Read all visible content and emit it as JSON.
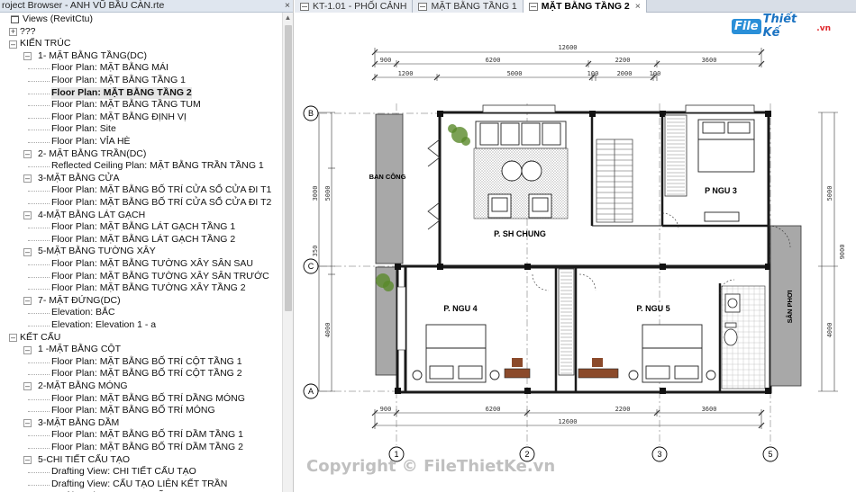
{
  "browser": {
    "title": "roject Browser - ANH VŨ BẦU CÀN.rte",
    "close": "×"
  },
  "tree": [
    {
      "label": "Views (RevitCtu)",
      "level": 0,
      "exp": "-",
      "icon": true
    },
    {
      "label": "???",
      "level": 1,
      "exp": "+"
    },
    {
      "label": "KIẾN TRÚC",
      "level": 1,
      "exp": "-"
    },
    {
      "label": "1- MẶT BẰNG TẦNG(DC)",
      "level": 2,
      "exp": "-"
    },
    {
      "label": "Floor Plan: MẶT BẰNG MÁI",
      "level": 3
    },
    {
      "label": "Floor Plan: MẶT BẰNG TẦNG 1",
      "level": 3
    },
    {
      "label": "Floor Plan: MẶT BẰNG TẦNG 2",
      "level": 3,
      "selected": true
    },
    {
      "label": "Floor Plan: MẶT BẰNG TẦNG TUM",
      "level": 3
    },
    {
      "label": "Floor Plan: MẶT BẰNG ĐỊNH VỊ",
      "level": 3
    },
    {
      "label": "Floor Plan: Site",
      "level": 3
    },
    {
      "label": "Floor Plan: VỈA HÈ",
      "level": 3
    },
    {
      "label": "2- MẶT BẰNG TRẦN(DC)",
      "level": 2,
      "exp": "-"
    },
    {
      "label": "Reflected Ceiling Plan: MẶT BẰNG TRẦN TẦNG 1",
      "level": 3
    },
    {
      "label": "3-MẶT BẰNG CỬA",
      "level": 2,
      "exp": "-"
    },
    {
      "label": "Floor Plan: MẶT BẰNG BỐ TRÍ CỬA SỔ CỬA ĐI T1",
      "level": 3
    },
    {
      "label": "Floor Plan: MẶT BẰNG BỐ TRÍ CỬA SỔ CỬA ĐI T2",
      "level": 3
    },
    {
      "label": "4-MẶT BẰNG LÁT GẠCH",
      "level": 2,
      "exp": "-"
    },
    {
      "label": "Floor Plan: MẶT BẰNG LÁT GẠCH TẦNG 1",
      "level": 3
    },
    {
      "label": "Floor Plan: MẶT BẰNG LÁT GẠCH TẦNG 2",
      "level": 3
    },
    {
      "label": "5-MẶT BẰNG TƯỜNG XÂY",
      "level": 2,
      "exp": "-"
    },
    {
      "label": "Floor Plan: MẶT BẰNG TƯỜNG XÂY SÂN SAU",
      "level": 3
    },
    {
      "label": "Floor Plan: MẶT BẰNG TƯỜNG XÂY SÂN TRƯỚC",
      "level": 3
    },
    {
      "label": "Floor Plan: MẶT BẰNG TƯỜNG XÂY TẦNG 2",
      "level": 3
    },
    {
      "label": "7- MẶT ĐỨNG(DC)",
      "level": 2,
      "exp": "-"
    },
    {
      "label": "Elevation: BẮC",
      "level": 3
    },
    {
      "label": "Elevation: Elevation 1 - a",
      "level": 3
    },
    {
      "label": "KẾT CẤU",
      "level": 1,
      "exp": "-"
    },
    {
      "label": "1 -MẶT BẰNG CỘT",
      "level": 2,
      "exp": "-"
    },
    {
      "label": "Floor Plan: MẶT BẰNG BỐ TRÍ CỘT TẦNG 1",
      "level": 3
    },
    {
      "label": "Floor Plan: MẶT BẰNG BỐ TRÍ CỘT TẦNG 2",
      "level": 3
    },
    {
      "label": "2-MẶT BẰNG MÓNG",
      "level": 2,
      "exp": "-"
    },
    {
      "label": "Floor Plan: MẶT BẰNG BỐ TRÍ DẦNG MÓNG",
      "level": 3
    },
    {
      "label": "Floor Plan: MẶT BẰNG BỐ TRÍ MÓNG",
      "level": 3
    },
    {
      "label": "3-MẶT BẰNG DẦM",
      "level": 2,
      "exp": "-"
    },
    {
      "label": "Floor Plan: MẶT BẰNG BỐ TRÍ DẦM TẦNG 1",
      "level": 3
    },
    {
      "label": "Floor Plan: MẶT BẰNG BỐ TRÍ DẦM TẦNG 2",
      "level": 3
    },
    {
      "label": "5-CHI TIẾT CẤU TẠO",
      "level": 2,
      "exp": "-"
    },
    {
      "label": "Drafting View: CHI TIẾT CẤU TẠO",
      "level": 3
    },
    {
      "label": "Drafting View: CẤU TẠO LIÊN KẾT TRẦN",
      "level": 3
    },
    {
      "label": "Drafting View: CHUNG MỸ",
      "level": 3
    }
  ],
  "tabs": [
    {
      "label": "KT-1.01 - PHỐI CẢNH",
      "active": false,
      "closable": false
    },
    {
      "label": "MẶT BẰNG TẦNG 1",
      "active": false,
      "closable": false
    },
    {
      "label": "MẶT BẰNG TẦNG 2",
      "active": true,
      "closable": true
    }
  ],
  "tab_close": "×",
  "drawing": {
    "rooms": {
      "ban_cong": "BAN CÔNG",
      "sh_chung": "P. SH CHUNG",
      "ngu3": "P NGU 3",
      "ngu4": "P. NGU 4",
      "ngu5": "P. NGU 5",
      "san_phoi": "SÂN PHƠI"
    },
    "dims_top": {
      "total": "12600",
      "a": "900",
      "b": "6200",
      "c": "2200",
      "d": "3600",
      "e": "1200",
      "f": "5000",
      "g": "100",
      "h": "2000",
      "i": "100"
    },
    "dims_bottom": {
      "total": "12600",
      "a": "900",
      "b": "6200",
      "c": "2200",
      "d": "3600"
    },
    "dims_left": {
      "a": "3000",
      "b": "5000",
      "c": "350",
      "d": "4000"
    },
    "dims_right": {
      "a": "5000",
      "b": "9000",
      "c": "4000"
    },
    "grid_rows": [
      "B",
      "C",
      "A"
    ],
    "grid_cols": [
      "1",
      "2",
      "3",
      "5"
    ]
  },
  "logo": {
    "badge": "File",
    "text": "Thiết Kế",
    "tld": ".vn"
  },
  "watermark": "Copyright © FileThietKe.vn",
  "colors": {
    "wall": "#1a1a1a",
    "hatch": "#9a9a9a",
    "balcony_fill": "#a8a8a8",
    "wood": "#8b4a2b",
    "plant": "#5a8a2a"
  }
}
